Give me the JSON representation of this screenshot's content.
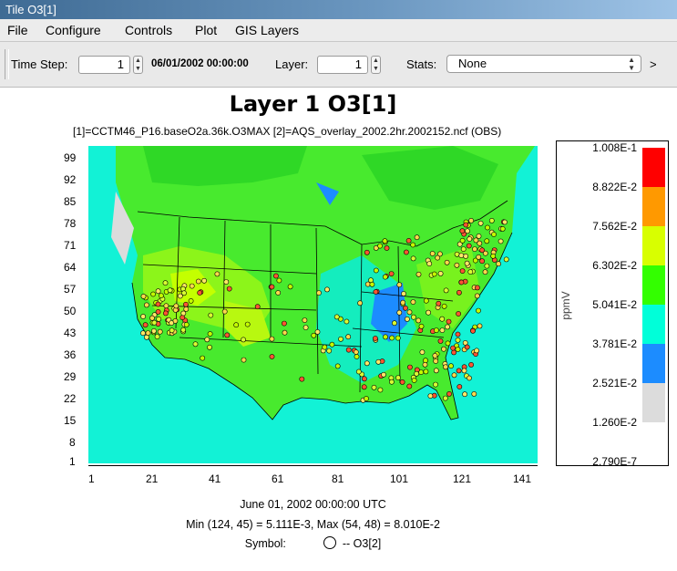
{
  "window": {
    "title": "Tile O3[1]"
  },
  "menu": [
    "File",
    "Configure",
    "Controls",
    "Plot",
    "GIS Layers"
  ],
  "toolbar": {
    "time_step_label": "Time Step:",
    "time_step_value": "1",
    "datetime": "06/01/2002 00:00:00",
    "layer_label": "Layer:",
    "layer_value": "1",
    "stats_label": "Stats:",
    "stats_value": "None",
    "more": ">"
  },
  "plot": {
    "title": "Layer 1 O3[1]",
    "files": "[1]=CCTM46_P16.baseO2a.36k.O3MAX  [2]=AQS_overlay_2002.2hr.2002152.ncf (OBS)",
    "date": "June 01, 2002 00:00:00 UTC",
    "minmax": "Min (124, 45) = 5.111E-3, Max (54, 48) = 8.010E-2",
    "symbol_label": "Symbol:",
    "symbol_text": "-- O3[2]",
    "y_ticks": [
      "99",
      "92",
      "85",
      "78",
      "71",
      "64",
      "57",
      "50",
      "43",
      "36",
      "29",
      "22",
      "15",
      "8",
      "1"
    ],
    "x_ticks": [
      "1",
      "21",
      "41",
      "61",
      "81",
      "101",
      "121",
      "141"
    ]
  },
  "legend": {
    "unit": "ppmV",
    "labels": [
      "1.008E-1",
      "8.822E-2",
      "7.562E-2",
      "6.302E-2",
      "5.041E-2",
      "3.781E-2",
      "2.521E-2",
      "1.260E-2",
      "2.790E-7"
    ],
    "colors": [
      "#ff0000",
      "#ff9900",
      "#d8ff00",
      "#33ff00",
      "#00ffd9",
      "#1c8cff",
      "#dcdcdc"
    ]
  }
}
